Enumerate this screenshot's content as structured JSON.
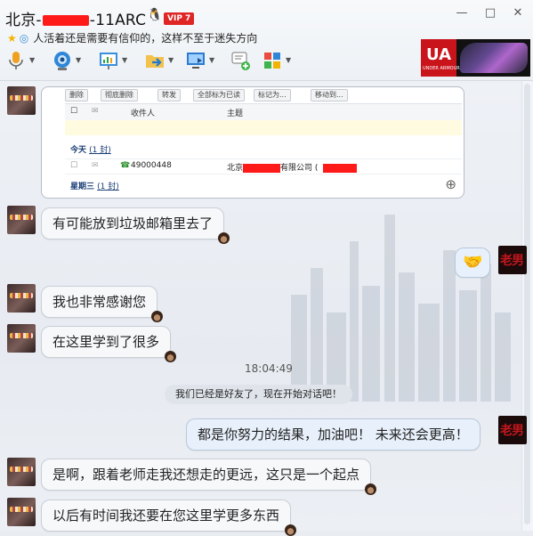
{
  "window": {
    "title_prefix": "北京-",
    "title_suffix": "-11ARC",
    "vip_badge": "VIP 7",
    "status_message": "人活着还是需要有信仰的，这样不至于迷失方向",
    "controls": {
      "min": "—",
      "max": "□",
      "close": "✕"
    }
  },
  "toolbar": {
    "items": [
      "voice-call",
      "video-call",
      "screen-share",
      "file-transfer",
      "remote-assist",
      "sms",
      "apps"
    ]
  },
  "ad": {
    "logo": "UA",
    "sub": "UNDER ARMOUR"
  },
  "screenshot": {
    "buttons": [
      "删除",
      "彻底删除",
      "转发",
      "全部标为已读",
      "标记为...",
      "移动到..."
    ],
    "col_recipient": "收件人",
    "col_subject": "主题",
    "group_today": "今天",
    "group_today_count": "(1 封)",
    "row_phone": "49000448",
    "row_subject_a": "北京",
    "row_subject_b": "有限公司 (",
    "group_wed": "星期三",
    "group_wed_count": "(1 封)"
  },
  "messages": [
    {
      "side": "left",
      "text": "有可能放到垃圾邮箱里去了"
    },
    {
      "side": "right",
      "text": "🤝"
    },
    {
      "side": "left",
      "text": "我也非常感谢您"
    },
    {
      "side": "left",
      "text": "在这里学到了很多"
    },
    {
      "side": "right",
      "text": "都是你努力的结果，加油吧！ 未来还会更高！"
    },
    {
      "side": "left",
      "text": "是啊，跟着老师走我还想走的更远，这只是一个起点"
    },
    {
      "side": "left",
      "text": "以后有时间我还要在您这里学更多东西"
    }
  ],
  "timestamp": "18:04:49",
  "system_message": "我们已经是好友了，现在开始对话吧！",
  "my_avatar_text": "老男"
}
